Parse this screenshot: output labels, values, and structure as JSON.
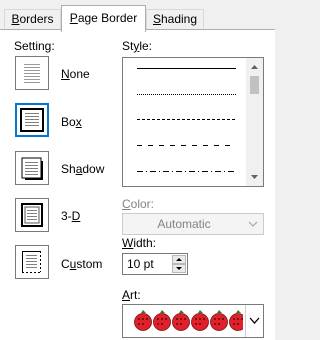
{
  "tabs": [
    {
      "pre": "",
      "acc": "B",
      "post": "orders"
    },
    {
      "pre": "",
      "acc": "P",
      "post": "age Border"
    },
    {
      "pre": "",
      "acc": "S",
      "post": "hading"
    }
  ],
  "setting": {
    "label": {
      "pre": "Setting:",
      "acc": "",
      "post": ""
    },
    "options": [
      {
        "pre": "",
        "acc": "N",
        "post": "one",
        "icon": "no-border-icon"
      },
      {
        "pre": "Bo",
        "acc": "x",
        "post": "",
        "icon": "box-border-icon",
        "selected": true
      },
      {
        "pre": "Sh",
        "acc": "a",
        "post": "dow",
        "icon": "shadow-border-icon"
      },
      {
        "pre": "3-",
        "acc": "D",
        "post": "",
        "icon": "3d-border-icon"
      },
      {
        "pre": "C",
        "acc": "u",
        "post": "stom",
        "icon": "custom-border-icon"
      }
    ]
  },
  "style": {
    "label": {
      "pre": "St",
      "acc": "y",
      "post": "le:"
    },
    "line_styles": [
      "solid",
      "dotted",
      "dashed-small",
      "dashed",
      "dash-dot"
    ]
  },
  "color": {
    "label": {
      "pre": "",
      "acc": "C",
      "post": "olor:"
    },
    "value": "Automatic"
  },
  "width": {
    "label": {
      "pre": "",
      "acc": "W",
      "post": "idth:"
    },
    "value": "10 pt"
  },
  "art": {
    "label": {
      "pre": "",
      "acc": "A",
      "post": "rt:"
    },
    "value": "apple border",
    "color": "#e0202a"
  },
  "colors": {
    "accent": "#0078d7"
  }
}
